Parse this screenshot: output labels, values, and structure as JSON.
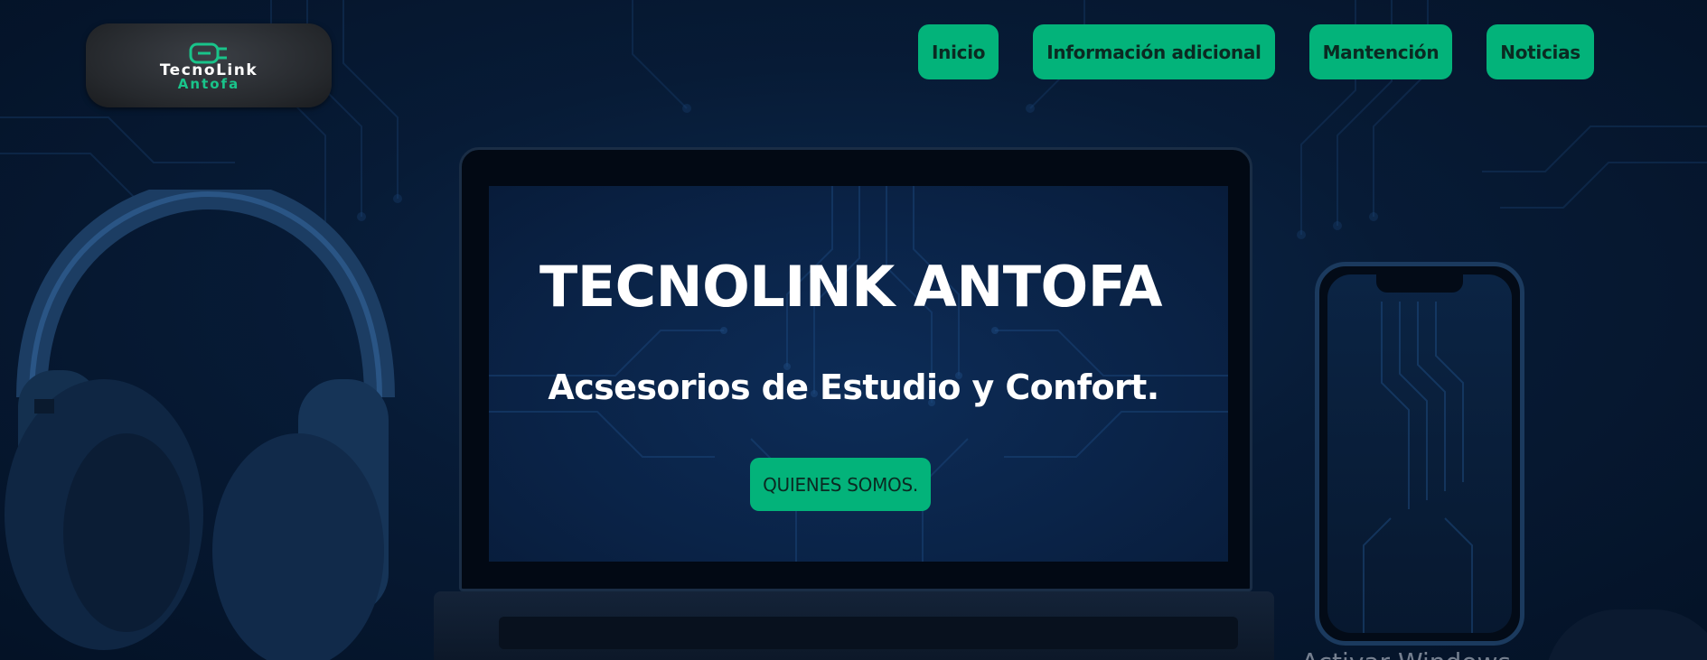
{
  "brand": {
    "logo_line_1": "TecnoLink",
    "logo_line_2": "Antofa",
    "accent_color": "#03b37a"
  },
  "nav": {
    "items": [
      {
        "label": "Inicio"
      },
      {
        "label": "Información adicional"
      },
      {
        "label": "Mantención"
      },
      {
        "label": "Noticias"
      }
    ]
  },
  "hero": {
    "title": "TECNOLINK ANTOFA",
    "subtitle": "Acsesorios de Estudio y Confort.",
    "cta_label": "QUIENES SOMOS."
  },
  "overlay": {
    "watermark_text": "Activar Windows"
  },
  "icons": {
    "logo_symbol": "plug-icon"
  }
}
